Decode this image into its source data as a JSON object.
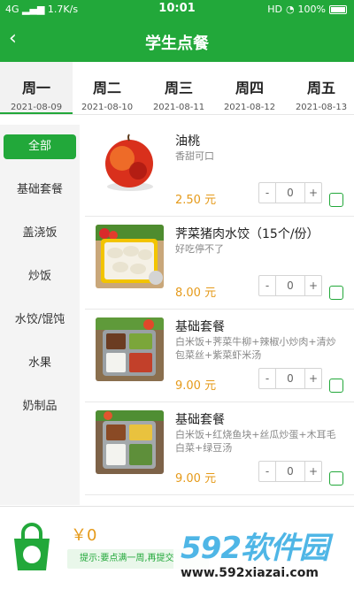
{
  "status": {
    "signal": "4G",
    "speed": "1.7K/s",
    "time": "10:01",
    "hd": "HD",
    "battery": "100%"
  },
  "nav": {
    "back_icon": "‹",
    "title": "学生点餐"
  },
  "week": [
    {
      "name": "周一",
      "date": "2021-08-09"
    },
    {
      "name": "周二",
      "date": "2021-08-10"
    },
    {
      "name": "周三",
      "date": "2021-08-11"
    },
    {
      "name": "周四",
      "date": "2021-08-12"
    },
    {
      "name": "周五",
      "date": "2021-08-13"
    }
  ],
  "categories": [
    "全部",
    "基础套餐",
    "盖浇饭",
    "炒饭",
    "水饺/馄饨",
    "水果",
    "奶制品"
  ],
  "items": [
    {
      "name": "油桃",
      "desc": "香甜可口",
      "price": "2.50 元",
      "qty": "0",
      "minus": "-",
      "plus": "+"
    },
    {
      "name": "荠菜猪肉水饺（15个/份）",
      "desc": "好吃停不了",
      "price": "8.00 元",
      "qty": "0",
      "minus": "-",
      "plus": "+"
    },
    {
      "name": "基础套餐",
      "desc": "白米饭+荠菜牛柳+辣椒小炒肉+清炒包菜丝+紫菜虾米汤",
      "price": "9.00 元",
      "qty": "0",
      "minus": "-",
      "plus": "+"
    },
    {
      "name": "基础套餐",
      "desc": "白米饭+红烧鱼块+丝瓜炒蛋+木耳毛白菜+绿豆汤",
      "price": "9.00 元",
      "qty": "0",
      "minus": "-",
      "plus": "+"
    }
  ],
  "footer": {
    "total": "￥0",
    "tip": "提示:要点满一周,再提交"
  },
  "watermark": {
    "logo": "592软件园",
    "url": "www.592xiazai.com"
  },
  "colors": {
    "brand": "#22a83a",
    "price": "#e59a1a"
  }
}
